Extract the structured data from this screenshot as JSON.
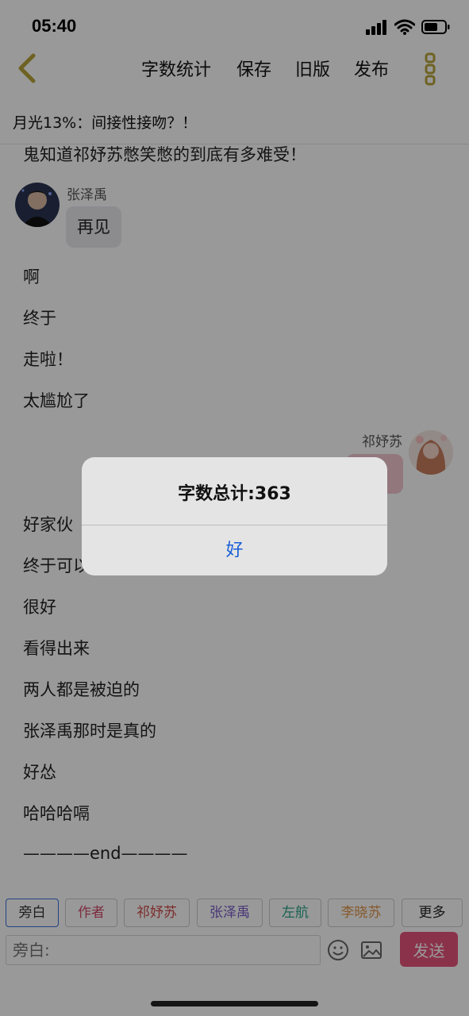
{
  "status_bar": {
    "time": "05:40"
  },
  "nav": {
    "back_icon": "chevron-left-icon",
    "items": [
      "字数统计",
      "保存",
      "旧版",
      "发布"
    ],
    "more_icon": "vertical-dots-icon",
    "accent_color": "#b8a33a"
  },
  "story_title": "月光13%：间接性接吻？！",
  "content": {
    "top_line": "鬼知道祁妤苏憋笑憋的到底有多难受！",
    "left_message": {
      "name": "张泽禹",
      "text": "再见"
    },
    "lines_a": [
      "啊",
      "终于",
      "走啦！",
      "太尴尬了"
    ],
    "right_message": {
      "name": "祁妤苏"
    },
    "lines_b": [
      "好家伙",
      "终于可以",
      "很好",
      "看得出来",
      "两人都是被迫的",
      "张泽禹那时是真的",
      "好怂",
      "哈哈哈嗝",
      "————end————"
    ]
  },
  "roles": [
    {
      "label": "旁白",
      "color": "#333333",
      "border": "#3a6fd8"
    },
    {
      "label": "作者",
      "color": "#d04a6a",
      "border": "#cccccc"
    },
    {
      "label": "祁妤苏",
      "color": "#d04a4a",
      "border": "#cccccc"
    },
    {
      "label": "张泽禹",
      "color": "#7a5bc7",
      "border": "#cccccc"
    },
    {
      "label": "左航",
      "color": "#2aa58a",
      "border": "#cccccc"
    },
    {
      "label": "李晓苏",
      "color": "#e0944a",
      "border": "#cccccc"
    },
    {
      "label": "更多",
      "color": "#222222",
      "border": "#cccccc"
    }
  ],
  "input": {
    "placeholder": "旁白:",
    "send_label": "发送"
  },
  "dialog": {
    "message": "字数总计:363",
    "ok_label": "好"
  }
}
